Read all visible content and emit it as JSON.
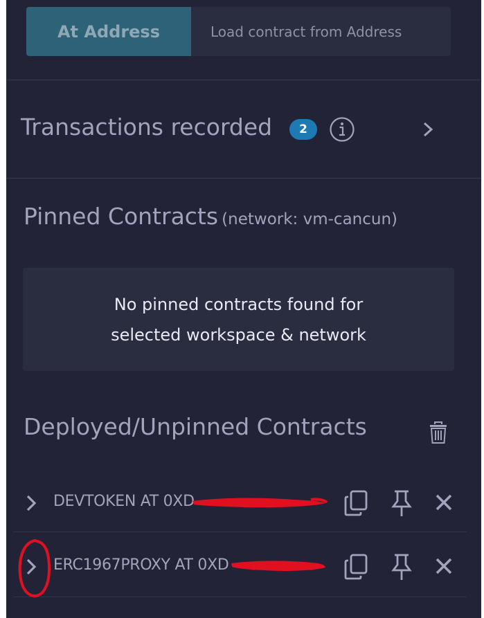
{
  "at_address": {
    "button_label": "At Address",
    "input_placeholder": "Load contract from Address"
  },
  "transactions": {
    "label": "Transactions recorded",
    "count": "2"
  },
  "pinned": {
    "title": "Pinned Contracts",
    "network": "(network: vm-cancun)",
    "empty_message": "No pinned contracts found for\nselected workspace & network"
  },
  "deployed": {
    "title": "Deployed/Unpinned Contracts",
    "contracts": [
      {
        "name": "DEVTOKEN AT 0XD"
      },
      {
        "name": "ERC1967PROXY AT 0XD"
      }
    ]
  },
  "colors": {
    "background": "#222336",
    "accent_button": "#2d6279",
    "badge": "#1e7ab3",
    "redaction": "#e01020",
    "annotation": "#e01020"
  },
  "icons": {
    "info": "info-icon",
    "chevron": "chevron-right-icon",
    "trash": "trash-icon",
    "copy": "copy-icon",
    "pin": "pin-icon",
    "close": "close-icon"
  }
}
